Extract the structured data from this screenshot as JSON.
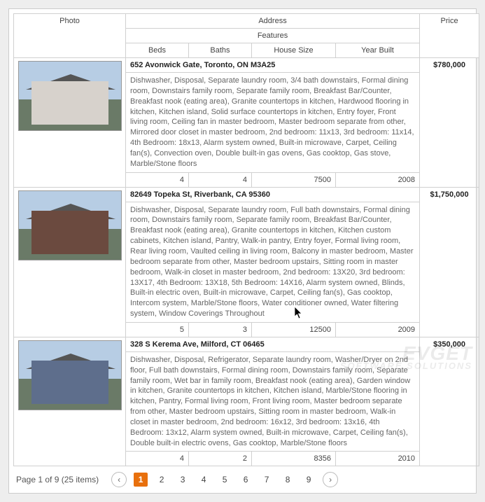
{
  "headers": {
    "photo": "Photo",
    "address": "Address",
    "features": "Features",
    "price": "Price",
    "beds": "Beds",
    "baths": "Baths",
    "house_size": "House Size",
    "year_built": "Year Built"
  },
  "listings": [
    {
      "address": "652 Avonwick Gate, Toronto, ON M3A25",
      "description": "Dishwasher, Disposal, Separate laundry room, 3/4 bath downstairs, Formal dining room, Downstairs family room, Separate family room, Breakfast Bar/Counter, Breakfast nook (eating area), Granite countertops in kitchen, Hardwood flooring in kitchen, Kitchen island, Solid surface countertops in kitchen, Entry foyer, Front living room, Ceiling fan in master bedroom, Master bedroom separate from other, Mirrored door closet in master bedroom, 2nd bedroom: 11x13, 3rd bedroom: 11x14, 4th Bedroom: 18x13, Alarm system owned, Built-in microwave, Carpet, Ceiling fan(s), Convection oven, Double built-in gas ovens, Gas cooktop, Gas stove, Marble/Stone floors",
      "beds": "4",
      "baths": "4",
      "house_size": "7500",
      "year_built": "2008",
      "price": "$780,000",
      "img_variant": "light"
    },
    {
      "address": "82649 Topeka St, Riverbank, CA 95360",
      "description": "Dishwasher, Disposal, Separate laundry room, Full bath downstairs, Formal dining room, Downstairs family room, Separate family room, Breakfast Bar/Counter, Breakfast nook (eating area), Granite countertops in kitchen, Kitchen custom cabinets, Kitchen island, Pantry, Walk-in pantry, Entry foyer, Formal living room, Rear living room, Vaulted ceiling in living room, Balcony in master bedroom, Master bedroom separate from other, Master bedroom upstairs, Sitting room in master bedroom, Walk-in closet in master bedroom, 2nd bedroom: 13X20, 3rd bedroom: 13X17, 4th Bedroom: 13X18, 5th Bedroom: 14X16, Alarm system owned, Blinds, Built-in electric oven, Built-in microwave, Carpet, Ceiling fan(s), Gas cooktop, Intercom system, Marble/Stone floors, Water conditioner owned, Water filtering system, Window Coverings Throughout",
      "beds": "5",
      "baths": "3",
      "house_size": "12500",
      "year_built": "2009",
      "price": "$1,750,000",
      "img_variant": "dark"
    },
    {
      "address": "328 S Kerema Ave, Milford, CT 06465",
      "description": "Dishwasher, Disposal, Refrigerator, Separate laundry room, Washer/Dryer on 2nd floor, Full bath downstairs, Formal dining room, Downstairs family room, Separate family room, Wet bar in family room, Breakfast nook (eating area), Garden window in kitchen, Granite countertops in kitchen, Kitchen island, Marble/Stone flooring in kitchen, Pantry, Formal living room, Front living room, Master bedroom separate from other, Master bedroom upstairs, Sitting room in master bedroom, Walk-in closet in master bedroom, 2nd bedroom: 16x12, 3rd bedroom: 13x16, 4th Bedroom: 13x12, Alarm system owned, Built-in microwave, Carpet, Ceiling fan(s), Double built-in electric ovens, Gas cooktop, Marble/Stone floors",
      "beds": "4",
      "baths": "2",
      "house_size": "8356",
      "year_built": "2010",
      "price": "$350,000",
      "img_variant": "blue"
    }
  ],
  "pager": {
    "summary": "Page 1 of 9 (25 items)",
    "prev_glyph": "‹",
    "next_glyph": "›",
    "current": 1,
    "pages": [
      "1",
      "2",
      "3",
      "4",
      "5",
      "6",
      "7",
      "8",
      "9"
    ]
  },
  "watermark": {
    "line1": "EVGET",
    "line2": "SOFTWARE SOLUTIONS"
  }
}
